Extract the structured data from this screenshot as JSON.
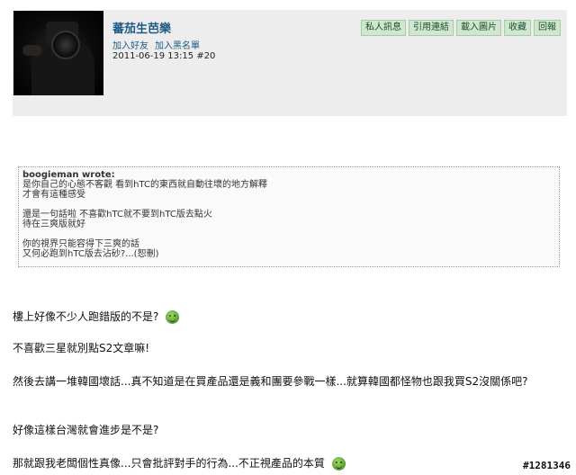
{
  "author": {
    "name": "蕃茄生芭樂",
    "add_friend": "加入好友",
    "add_blacklist": "加入黑名單",
    "timestamp": "2011-06-19 13:15",
    "post_number": "#20"
  },
  "toolbar": {
    "buttons": [
      "私人訊息",
      "引用連結",
      "載入圖片",
      "收藏",
      "回報"
    ]
  },
  "quote": {
    "author_line": "boogieman wrote:",
    "lines": [
      "是你自己的心態不客觀 看到hTC的東西就自動往壞的地方解釋",
      "才會有這種感受",
      "",
      "還是一句話啦 不喜歡hTC就不要到hTC版去點火",
      "待在三爽版就好",
      "",
      "你的視界只能容得下三爽的話",
      "又何必跑到hTC版去沾砂?...(恕刪)"
    ]
  },
  "post": {
    "paragraphs": [
      "樓上好像不少人跑錯版的不是?",
      "不喜歡三星就別點S2文章嘛!",
      "然後去講一堆韓國壞話...真不知道是在買產品還是義和團要參戰一樣...就算韓國都怪物也跟我買S2沒關係吧?",
      "好像這樣台灣就會進步是不是?",
      "那就跟我老闆個性真像...只會批評對手的行為...不正視產品的本質"
    ],
    "smiley_icon": "smiley-icon"
  },
  "watermark": "#1281346"
}
